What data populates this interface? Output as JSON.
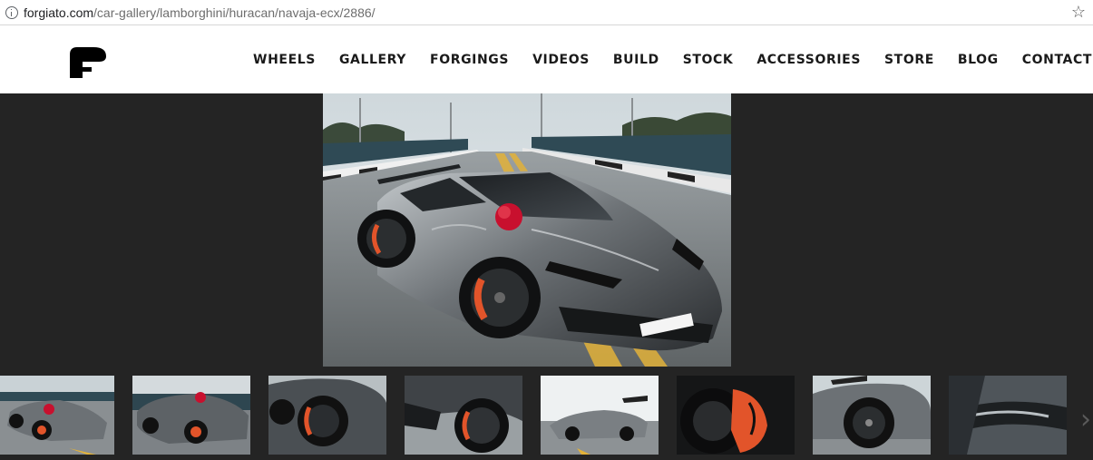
{
  "browser": {
    "url_host": "forgiato.com",
    "url_path": "/car-gallery/lamborghini/huracan/navaja-ecx/2886/",
    "info_icon": "info-icon",
    "bookmark_icon": "star-icon"
  },
  "site": {
    "logo": "forgiato-f-logo",
    "nav": [
      "WHEELS",
      "GALLERY",
      "FORGINGS",
      "VIDEOS",
      "BUILD",
      "STOCK",
      "ACCESSORIES",
      "STORE",
      "BLOG",
      "CONTACT"
    ]
  },
  "gallery": {
    "main_photo": "lamborghini-huracan-front-three-quarter",
    "thumbnail_count": 8,
    "next_icon": "chevron-right-icon"
  },
  "colors": {
    "page_background": "#242424",
    "header_background": "#ffffff",
    "nav_text": "#1a1a1a",
    "car_accent_red": "#c8102e",
    "car_caliper_orange": "#e2542a"
  }
}
